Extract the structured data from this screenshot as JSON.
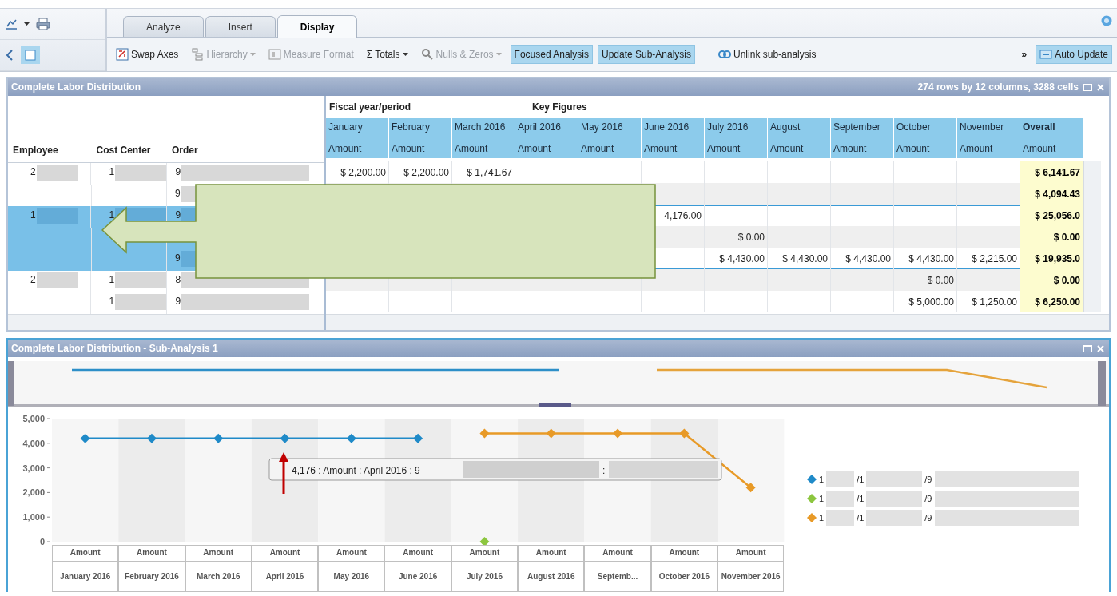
{
  "tabs": [
    {
      "label": "Analyze",
      "selected": false
    },
    {
      "label": "Insert",
      "selected": false
    },
    {
      "label": "Display",
      "selected": true
    }
  ],
  "toolbar": [
    {
      "kind": "button",
      "label": "Swap Axes",
      "disabled": false,
      "pressed": false,
      "dropdown": false
    },
    {
      "kind": "button",
      "label": "Hierarchy",
      "disabled": true,
      "pressed": false,
      "dropdown": true
    },
    {
      "kind": "button",
      "label": "Measure Format",
      "disabled": true,
      "pressed": false,
      "dropdown": false
    },
    {
      "kind": "button",
      "glyph": "Σ",
      "label": "Totals",
      "disabled": false,
      "pressed": false,
      "dropdown": true
    },
    {
      "kind": "button",
      "label": "Nulls & Zeros",
      "disabled": true,
      "pressed": false,
      "dropdown": true
    },
    {
      "kind": "button",
      "label": "Focused Analysis",
      "disabled": false,
      "pressed": true,
      "dropdown": false
    },
    {
      "kind": "button",
      "label": "Update Sub-Analysis",
      "disabled": false,
      "pressed": true,
      "dropdown": false
    },
    {
      "kind": "button",
      "label": "Unlink sub-analysis",
      "disabled": false,
      "pressed": false,
      "dropdown": false
    },
    {
      "kind": "overflow",
      "label": "»",
      "disabled": false,
      "pressed": false,
      "dropdown": false
    },
    {
      "kind": "button",
      "label": "Auto Update",
      "disabled": false,
      "pressed": true,
      "dropdown": false
    }
  ],
  "panel": {
    "title": "Complete Labor Distribution",
    "summary": "274 rows by 12 columns, 3288 cells",
    "row_headers": [
      "Employee",
      "Cost Center",
      "Order"
    ],
    "column_groups": [
      "Fiscal year/period",
      "Key Figures"
    ],
    "columns": [
      {
        "kind": "month",
        "period": "January",
        "measure": "Amount"
      },
      {
        "kind": "month",
        "period": "February",
        "measure": "Amount"
      },
      {
        "kind": "month",
        "period": "March 2016",
        "measure": "Amount"
      },
      {
        "kind": "month",
        "period": "April 2016",
        "measure": "Amount"
      },
      {
        "kind": "month",
        "period": "May 2016",
        "measure": "Amount"
      },
      {
        "kind": "month",
        "period": "June 2016",
        "measure": "Amount"
      },
      {
        "kind": "month",
        "period": "July 2016",
        "measure": "Amount"
      },
      {
        "kind": "month",
        "period": "August",
        "measure": "Amount"
      },
      {
        "kind": "month",
        "period": "September",
        "measure": "Amount"
      },
      {
        "kind": "month",
        "period": "October",
        "measure": "Amount"
      },
      {
        "kind": "month",
        "period": "November",
        "measure": "Amount"
      },
      {
        "kind": "total",
        "period": "Overall",
        "measure": "Amount"
      }
    ],
    "rows": [
      {
        "employee": "2",
        "cost_center": "1",
        "order": "9",
        "selected": false,
        "cells": [
          "$ 2,200.00",
          "$ 2,200.00",
          "$ 1,741.67",
          null,
          null,
          null,
          null,
          null,
          null,
          null,
          null,
          "$ 6,141.67"
        ]
      },
      {
        "order": "9",
        "selected": false,
        "cells": [
          null,
          null,
          null,
          null,
          null,
          null,
          null,
          null,
          null,
          null,
          null,
          "$ 4,094.43"
        ]
      },
      {
        "employee": "1",
        "cost_center": "1",
        "order": "9",
        "selected": true,
        "cells": [
          null,
          null,
          null,
          null,
          null,
          "4,176.00",
          null,
          null,
          null,
          null,
          null,
          "$ 25,056.0"
        ]
      },
      {
        "selected": true,
        "cells": [
          null,
          null,
          null,
          null,
          null,
          null,
          "$ 0.00",
          null,
          null,
          null,
          null,
          "$ 0.00"
        ]
      },
      {
        "order": "9",
        "selected": true,
        "cells": [
          null,
          null,
          null,
          null,
          null,
          null,
          "$ 4,430.00",
          "$ 4,430.00",
          "$ 4,430.00",
          "$ 4,430.00",
          "$ 2,215.00",
          "$ 19,935.0"
        ]
      },
      {
        "employee": "2",
        "cost_center": "1",
        "order": "8",
        "selected": false,
        "cells": [
          null,
          null,
          null,
          null,
          null,
          null,
          null,
          null,
          null,
          "$ 0.00",
          null,
          "$ 0.00"
        ]
      },
      {
        "cost_center": "1",
        "order": "9",
        "selected": false,
        "cells": [
          null,
          null,
          null,
          null,
          null,
          null,
          null,
          null,
          null,
          "$ 5,000.00",
          "$ 1,250.00",
          "$ 6,250.00"
        ]
      }
    ]
  },
  "sub_panel": {
    "title": "Complete Labor Distribution - Sub-Analysis 1",
    "category_headers": [
      "Amount",
      "Amount",
      "Amount",
      "Amount",
      "Amount",
      "Amount",
      "Amount",
      "Amount",
      "Amount",
      "Amount",
      "Amount"
    ],
    "tooltip": {
      "text": "4,176 : Amount : April 2016 : 9",
      "tail": ":"
    },
    "chart_data": {
      "type": "line",
      "categories": [
        "January 2016",
        "February 2016",
        "March 2016",
        "April 2016",
        "May 2016",
        "June 2016",
        "July 2016",
        "August 2016",
        "Septemb...",
        "October 2016",
        "November 2016"
      ],
      "ylim": [
        0,
        5000
      ],
      "yticks": [
        {
          "value": 0,
          "label": "0"
        },
        {
          "value": 1000,
          "label": "1,000"
        },
        {
          "value": 2000,
          "label": "2,000"
        },
        {
          "value": 3000,
          "label": "3,000"
        },
        {
          "value": 4000,
          "label": "4,000"
        },
        {
          "value": 5000,
          "label": "5,000"
        }
      ],
      "series": [
        {
          "name": "1 /1 /9",
          "color": "#1f8ac8",
          "marker": "diamond",
          "values": [
            4200,
            4200,
            4200,
            4200,
            4200,
            4200,
            null,
            null,
            null,
            null,
            null
          ]
        },
        {
          "name": "1 /1 /9",
          "color": "#8cc63f",
          "marker": "diamond",
          "values": [
            null,
            null,
            null,
            null,
            null,
            null,
            0,
            null,
            null,
            null,
            null
          ]
        },
        {
          "name": "1 /1 /9",
          "color": "#e89a27",
          "marker": "diamond",
          "values": [
            null,
            null,
            null,
            null,
            null,
            null,
            4400,
            4400,
            4400,
            4400,
            2200
          ]
        }
      ]
    }
  }
}
